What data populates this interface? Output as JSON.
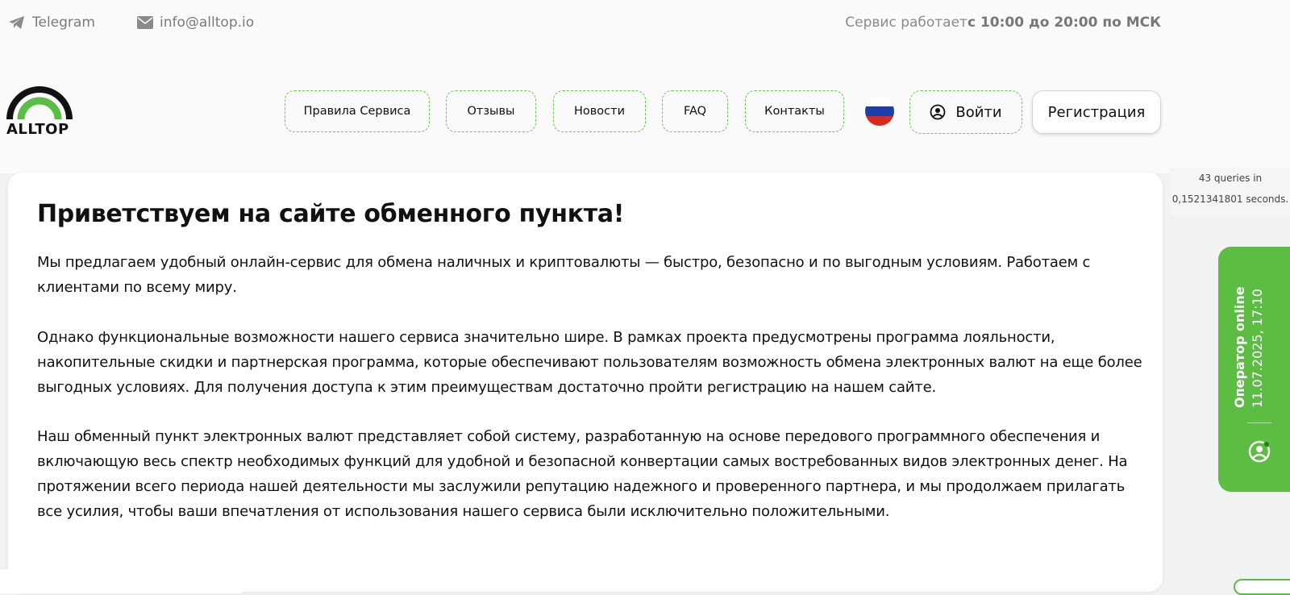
{
  "topline": {
    "telegram_label": "Telegram",
    "email_label": "info@alltop.io",
    "schedule_prefix": "Сервис работает",
    "schedule_hours": "с 10:00 до 20:00 по МСК"
  },
  "logo": {
    "text": "ALLTOP"
  },
  "nav": {
    "items": [
      "Правила Сервиса",
      "Отзывы",
      "Новости",
      "FAQ",
      "Контакты"
    ],
    "login_label": "Войти",
    "register_label": "Регистрация",
    "language_flag": "ru-flag"
  },
  "main": {
    "title": "Приветствуем на сайте обменного пункта!",
    "paragraphs": [
      "Мы предлагаем удобный онлайн-сервис для обмена наличных и криптовалюты — быстро, безопасно и по выгодным условиям. Работаем с клиентами по всему миру.",
      "Однако функциональные возможности нашего сервиса значительно шире. В рамках проекта предусмотрены программа лояльности, накопительные скидки и партнерская программа, которые обеспечивают пользователям возможность обмена электронных валют на еще более выгодных условиях. Для получения доступа к этим преимуществам достаточно пройти регистрацию на нашем сайте.",
      "Наш обменный пункт электронных валют представляет собой систему, разработанную на основе передового программного обеспечения и включающую весь спектр необходимых функций для удобной и безопасной конвертации самых востребованных видов электронных денег. На протяжении всего периода нашей деятельности мы заслужили репутацию надежного и проверенного партнера, и мы продолжаем прилагать все усилия, чтобы ваши впечатления от использования нашего сервиса были исключительно положительными."
    ]
  },
  "debug": {
    "queries_line1": "43 queries in",
    "queries_line2": "0,1521341801 seconds."
  },
  "operator": {
    "status": "Оператор online",
    "datetime": "11.07.2025, 17:10"
  },
  "colors": {
    "accent_green": "#5cbd43",
    "dashed_border": "#6cc94f",
    "page_bg": "#f1f2f2"
  }
}
